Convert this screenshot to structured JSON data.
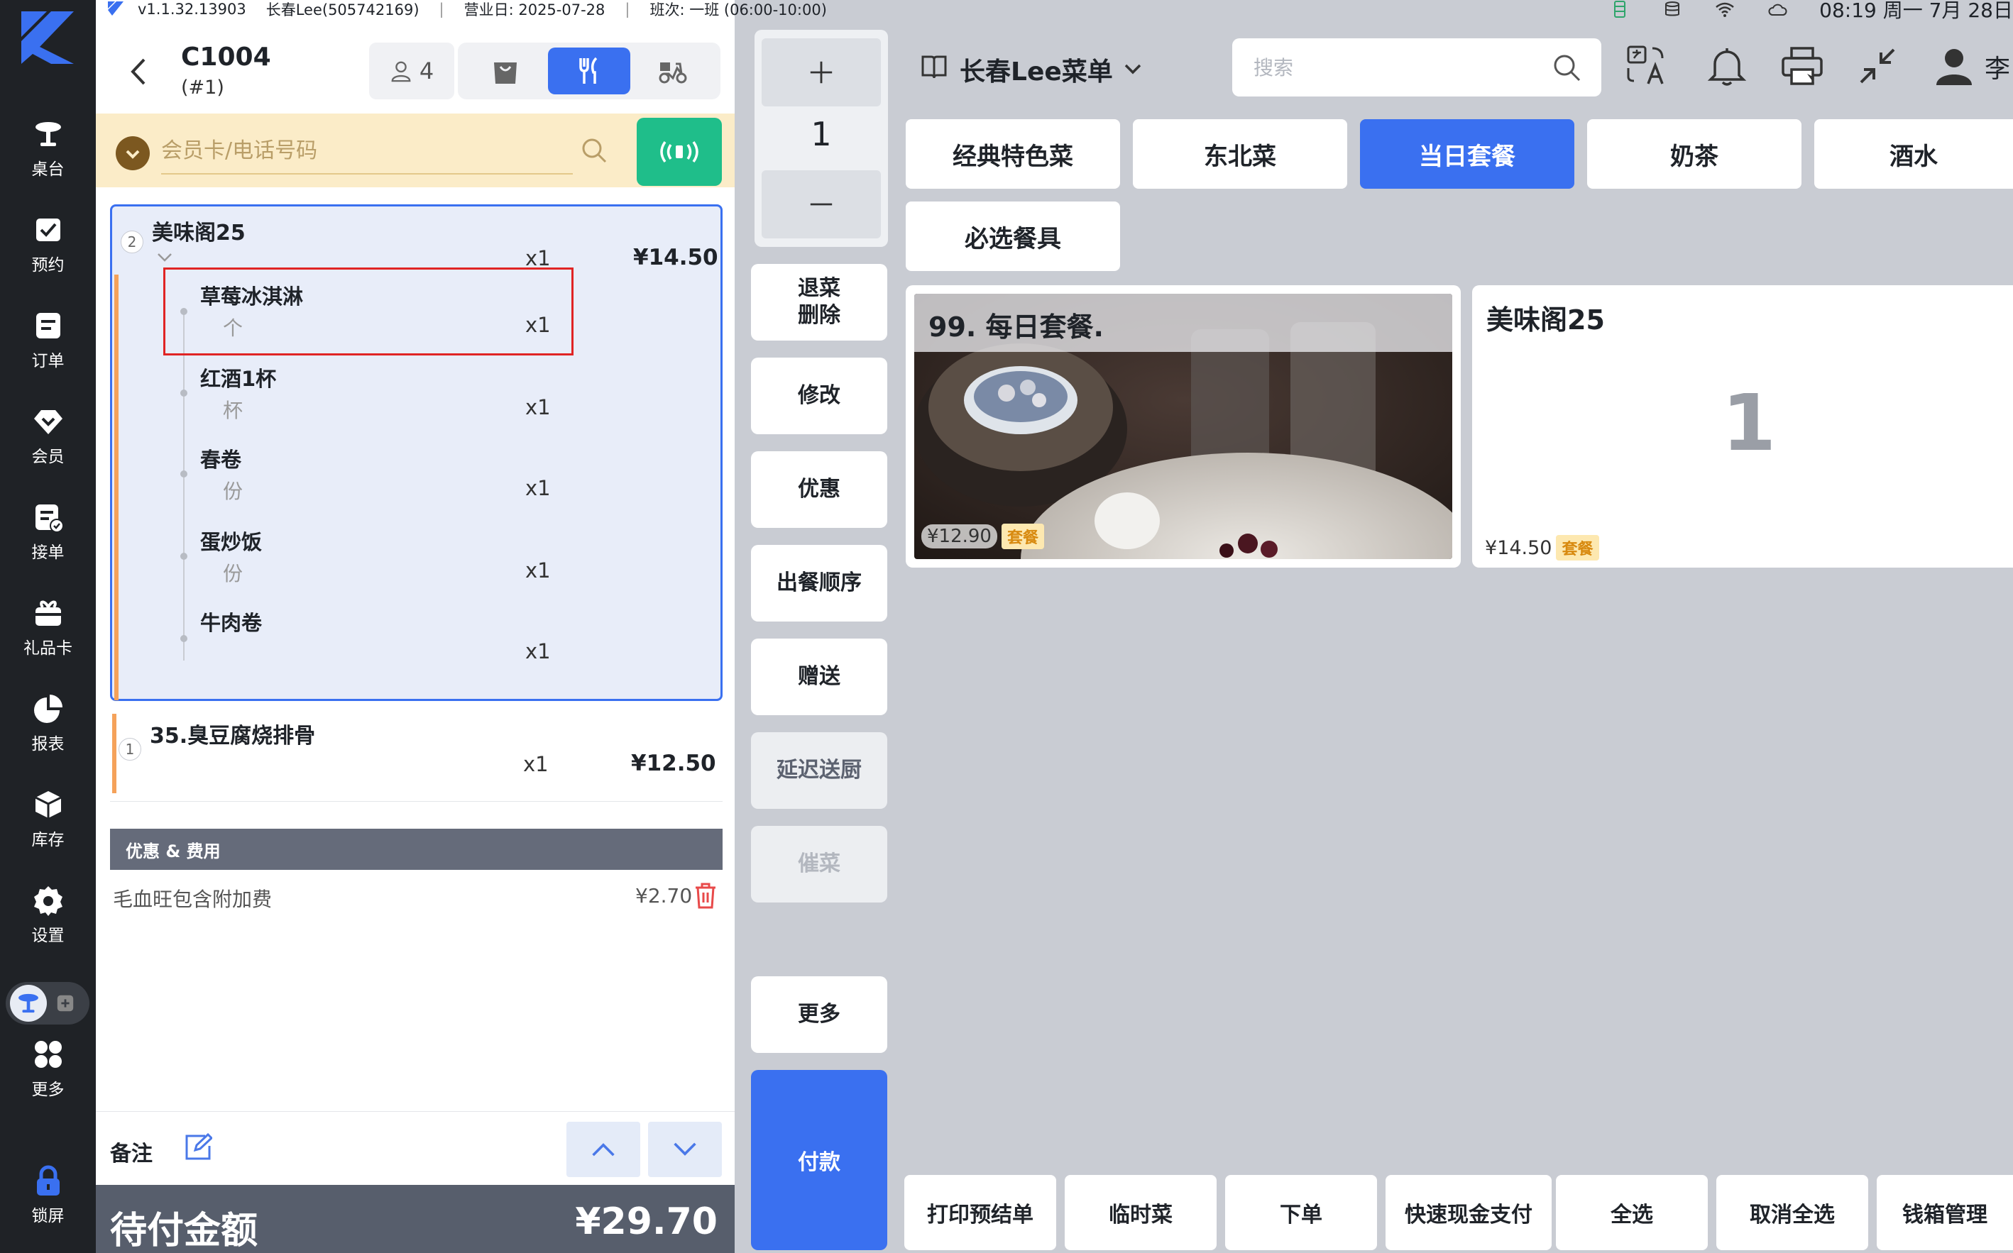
{
  "statusbar": {
    "version": "v1.1.32.13903",
    "store": "长春Lee(505742169)",
    "business_day": "营业日: 2025-07-28",
    "shift": "班次:    一班 (06:00-10:00)",
    "time": "08:19 周一 7月 28日"
  },
  "sidebar": {
    "items": [
      {
        "label": "桌台",
        "icon": "table-icon"
      },
      {
        "label": "预约",
        "icon": "reservation-icon"
      },
      {
        "label": "订单",
        "icon": "order-icon"
      },
      {
        "label": "会员",
        "icon": "member-icon"
      },
      {
        "label": "接单",
        "icon": "accept-order-icon"
      },
      {
        "label": "礼品卡",
        "icon": "gift-card-icon"
      },
      {
        "label": "报表",
        "icon": "report-icon"
      },
      {
        "label": "库存",
        "icon": "inventory-icon"
      },
      {
        "label": "设置",
        "icon": "settings-icon"
      },
      {
        "label": "更多",
        "icon": "more-icon"
      },
      {
        "label": "锁屏",
        "icon": "lock-icon"
      }
    ]
  },
  "order": {
    "table_no": "C1004",
    "table_sub": "(#1)",
    "guests": "4",
    "member_placeholder": "会员卡/电话号码",
    "items": [
      {
        "index": "2",
        "name": "美味阁25",
        "qty": "x1",
        "price": "¥14.50",
        "sub_items": [
          {
            "name": "草莓冰淇淋",
            "unit": "个",
            "qty": "x1"
          },
          {
            "name": "红酒1杯",
            "unit": "杯",
            "qty": "x1"
          },
          {
            "name": "春卷",
            "unit": "份",
            "qty": "x1"
          },
          {
            "name": "蛋炒饭",
            "unit": "份",
            "qty": "x1"
          },
          {
            "name": "牛肉卷",
            "unit": "",
            "qty": "x1"
          }
        ]
      },
      {
        "index": "1",
        "name": "35.臭豆腐烧排骨",
        "qty": "x1",
        "price": "¥12.50"
      }
    ],
    "fees_header": "优惠 & 费用",
    "fees": [
      {
        "name": "毛血旺包含附加费",
        "amount": "¥2.70"
      }
    ],
    "remark_label": "备注",
    "total_label": "待付金额",
    "total_value": "¥29.70"
  },
  "actions": {
    "qty_value": "1",
    "buttons": [
      {
        "label": "退菜\n删除",
        "state": "normal"
      },
      {
        "label": "修改",
        "state": "normal"
      },
      {
        "label": "优惠",
        "state": "normal"
      },
      {
        "label": "出餐顺序",
        "state": "normal"
      },
      {
        "label": "赠送",
        "state": "normal"
      },
      {
        "label": "延迟送厨",
        "state": "dim"
      },
      {
        "label": "催菜",
        "state": "disabled"
      },
      {
        "label": "更多",
        "state": "normal"
      }
    ],
    "pay_label": "付款"
  },
  "menu": {
    "title": "长春Lee菜单",
    "search_placeholder": "搜索",
    "user_name": "李",
    "categories": [
      {
        "label": "经典特色菜",
        "active": false
      },
      {
        "label": "东北菜",
        "active": false
      },
      {
        "label": "当日套餐",
        "active": true
      },
      {
        "label": "奶茶",
        "active": false
      },
      {
        "label": "酒水",
        "active": false
      },
      {
        "label": "必选餐具",
        "active": false
      }
    ],
    "dishes": [
      {
        "name": "99. 每日套餐.",
        "price": "¥12.90",
        "badge": "套餐"
      },
      {
        "name": "美味阁25",
        "price": "¥14.50",
        "badge": "套餐",
        "count": "1"
      }
    ],
    "bottom_buttons": [
      "打印预结单",
      "临时菜",
      "下单",
      "快速现金支付",
      "全选",
      "取消全选",
      "钱箱管理"
    ]
  },
  "colors": {
    "accent": "#3a70f0",
    "sidebar_bg": "#1f2226",
    "member_bar": "#fbecc8",
    "nfc_green": "#1fbe8a",
    "total_bar": "#575e6c",
    "highlight_red": "#e02424"
  }
}
